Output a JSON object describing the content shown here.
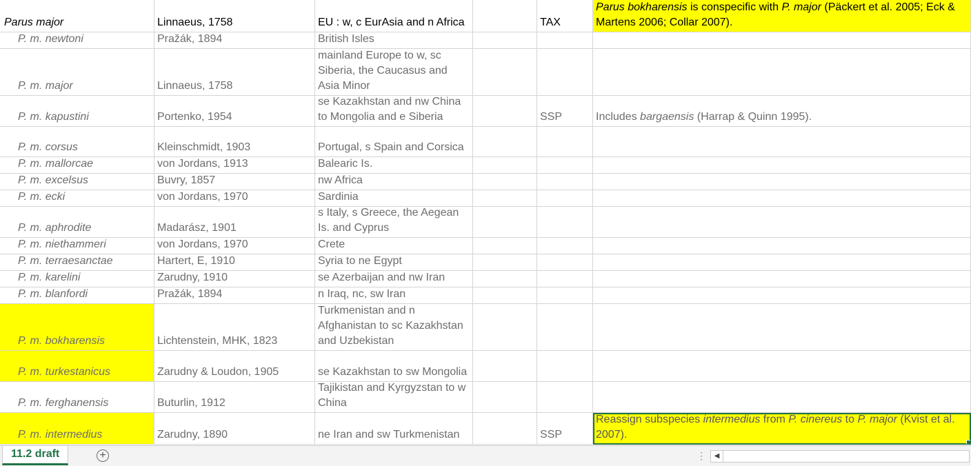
{
  "rows": [
    {
      "name": "Parus major",
      "author": "Linnaeus, 1758",
      "range": "EU : w, c EurAsia and n Africa",
      "code": "TAX",
      "notes": "<i>Parus bokharensis</i>  is conspecific with <i>P. major</i>  (Päckert et al. 2005; Eck &amp; Martens 2006; Collar 2007)."
    },
    {
      "name": "P. m. newtoni",
      "author": "Pražák, 1894",
      "range": "British Isles",
      "code": "",
      "notes": ""
    },
    {
      "name": "P. m. major",
      "author": "Linnaeus, 1758",
      "range": "mainland Europe to w, sc Siberia, the Caucasus and Asia Minor",
      "code": "",
      "notes": ""
    },
    {
      "name": "P. m. kapustini",
      "author": "Portenko, 1954",
      "range": "se Kazakhstan and nw China to Mongolia and e Siberia",
      "code": "SSP",
      "notes": "Includes <i>bargaensis</i>  (Harrap &amp; Quinn 1995)."
    },
    {
      "name": "P. m. corsus",
      "author": "Kleinschmidt, 1903",
      "range": "Portugal, s Spain and Corsica",
      "code": "",
      "notes": ""
    },
    {
      "name": "P. m. mallorcae",
      "author": "von Jordans, 1913",
      "range": "Balearic Is.",
      "code": "",
      "notes": ""
    },
    {
      "name": "P. m. excelsus",
      "author": "Buvry, 1857",
      "range": "nw Africa",
      "code": "",
      "notes": ""
    },
    {
      "name": "P. m. ecki",
      "author": "von Jordans, 1970",
      "range": "Sardinia",
      "code": "",
      "notes": ""
    },
    {
      "name": "P. m. aphrodite",
      "author": "Madarász, 1901",
      "range": "s Italy, s Greece, the Aegean Is. and Cyprus",
      "code": "",
      "notes": ""
    },
    {
      "name": "P. m. niethammeri",
      "author": "von Jordans, 1970",
      "range": "Crete",
      "code": "",
      "notes": ""
    },
    {
      "name": "P. m. terraesanctae",
      "author": "Hartert, E, 1910",
      "range": "Syria to ne Egypt",
      "code": "",
      "notes": ""
    },
    {
      "name": "P. m. karelini",
      "author": "Zarudny, 1910",
      "range": "se Azerbaijan and nw Iran",
      "code": "",
      "notes": ""
    },
    {
      "name": "P. m. blanfordi",
      "author": "Pražák, 1894",
      "range": "n Iraq, nc, sw Iran",
      "code": "",
      "notes": ""
    },
    {
      "name": "P. m. bokharensis",
      "author": "Lichtenstein, MHK, 1823",
      "range": "Turkmenistan and n Afghanistan to sc Kazakhstan and Uzbekistan",
      "code": "",
      "notes": ""
    },
    {
      "name": "P. m. turkestanicus",
      "author": "Zarudny & Loudon, 1905",
      "range": "se Kazakhstan to sw Mongolia",
      "code": "",
      "notes": ""
    },
    {
      "name": "P. m. ferghanensis",
      "author": "Buturlin, 1912",
      "range": "Tajikistan and Kyrgyzstan to w China",
      "code": "",
      "notes": ""
    },
    {
      "name": "P. m. intermedius",
      "author": "Zarudny, 1890",
      "range": "ne Iran and sw Turkmenistan",
      "code": "SSP",
      "notes": "Reassign subspecies <i>intermedius</i>  from <i>P. cinereus</i>  to <i>P. major</i>  (Kvist et al. 2007)."
    }
  ],
  "sheet_tab": "11.2 draft",
  "icons": {
    "add_sheet": "plus-circle-icon",
    "scroll_left": "triangle-left-icon",
    "more": "vertical-dots-icon"
  },
  "colors": {
    "highlight": "#ffff00",
    "excel_green": "#217346"
  }
}
